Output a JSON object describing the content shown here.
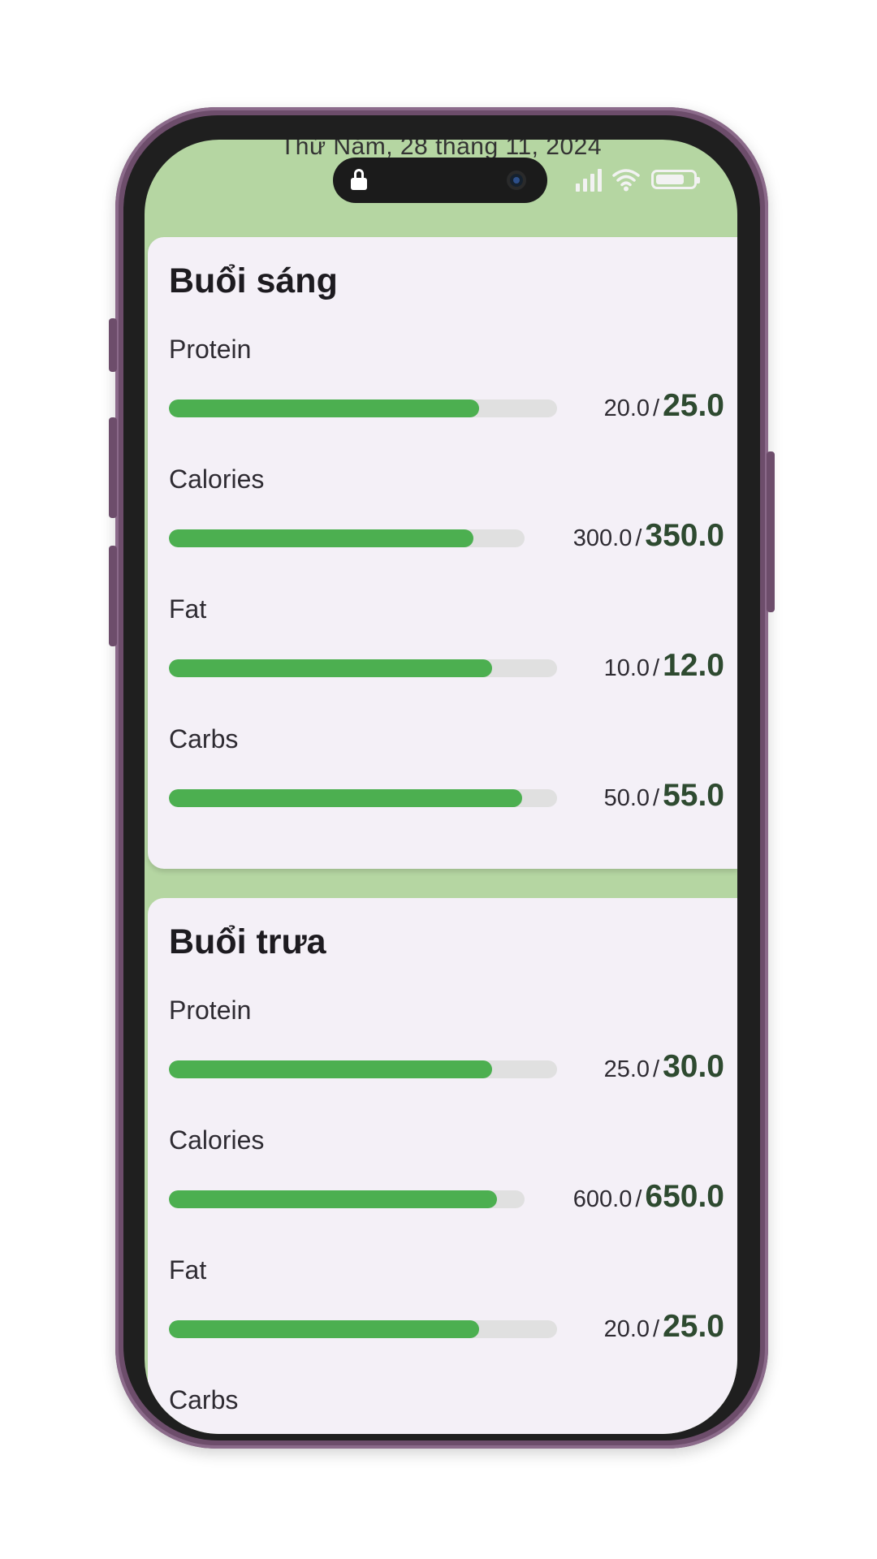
{
  "status_bar": {
    "date": "Thứ Năm, 28 tháng 11, 2024"
  },
  "colors": {
    "header_bg": "#b5d6a2",
    "card_bg": "#f4f0f7",
    "progress_fill": "#4caf50",
    "progress_track": "#e0e0e0",
    "target_text": "#2e4a30"
  },
  "icons": [
    "lock-icon",
    "camera-icon",
    "signal-icon",
    "wifi-icon",
    "battery-icon"
  ],
  "meals": [
    {
      "title": "Buổi sáng",
      "nutrients": [
        {
          "label": "Protein",
          "current": "20.0",
          "separator": "/",
          "target": "25.0",
          "progress": 0.8
        },
        {
          "label": "Calories",
          "current": "300.0",
          "separator": "/",
          "target": "350.0",
          "progress": 0.857
        },
        {
          "label": "Fat",
          "current": "10.0",
          "separator": "/",
          "target": "12.0",
          "progress": 0.833
        },
        {
          "label": "Carbs",
          "current": "50.0",
          "separator": "/",
          "target": "55.0",
          "progress": 0.909
        }
      ]
    },
    {
      "title": "Buổi trưa",
      "nutrients": [
        {
          "label": "Protein",
          "current": "25.0",
          "separator": "/",
          "target": "30.0",
          "progress": 0.833
        },
        {
          "label": "Calories",
          "current": "600.0",
          "separator": "/",
          "target": "650.0",
          "progress": 0.923
        },
        {
          "label": "Fat",
          "current": "20.0",
          "separator": "/",
          "target": "25.0",
          "progress": 0.8
        },
        {
          "label": "Carbs",
          "current": "",
          "separator": "",
          "target": "",
          "progress": 0
        }
      ]
    }
  ]
}
